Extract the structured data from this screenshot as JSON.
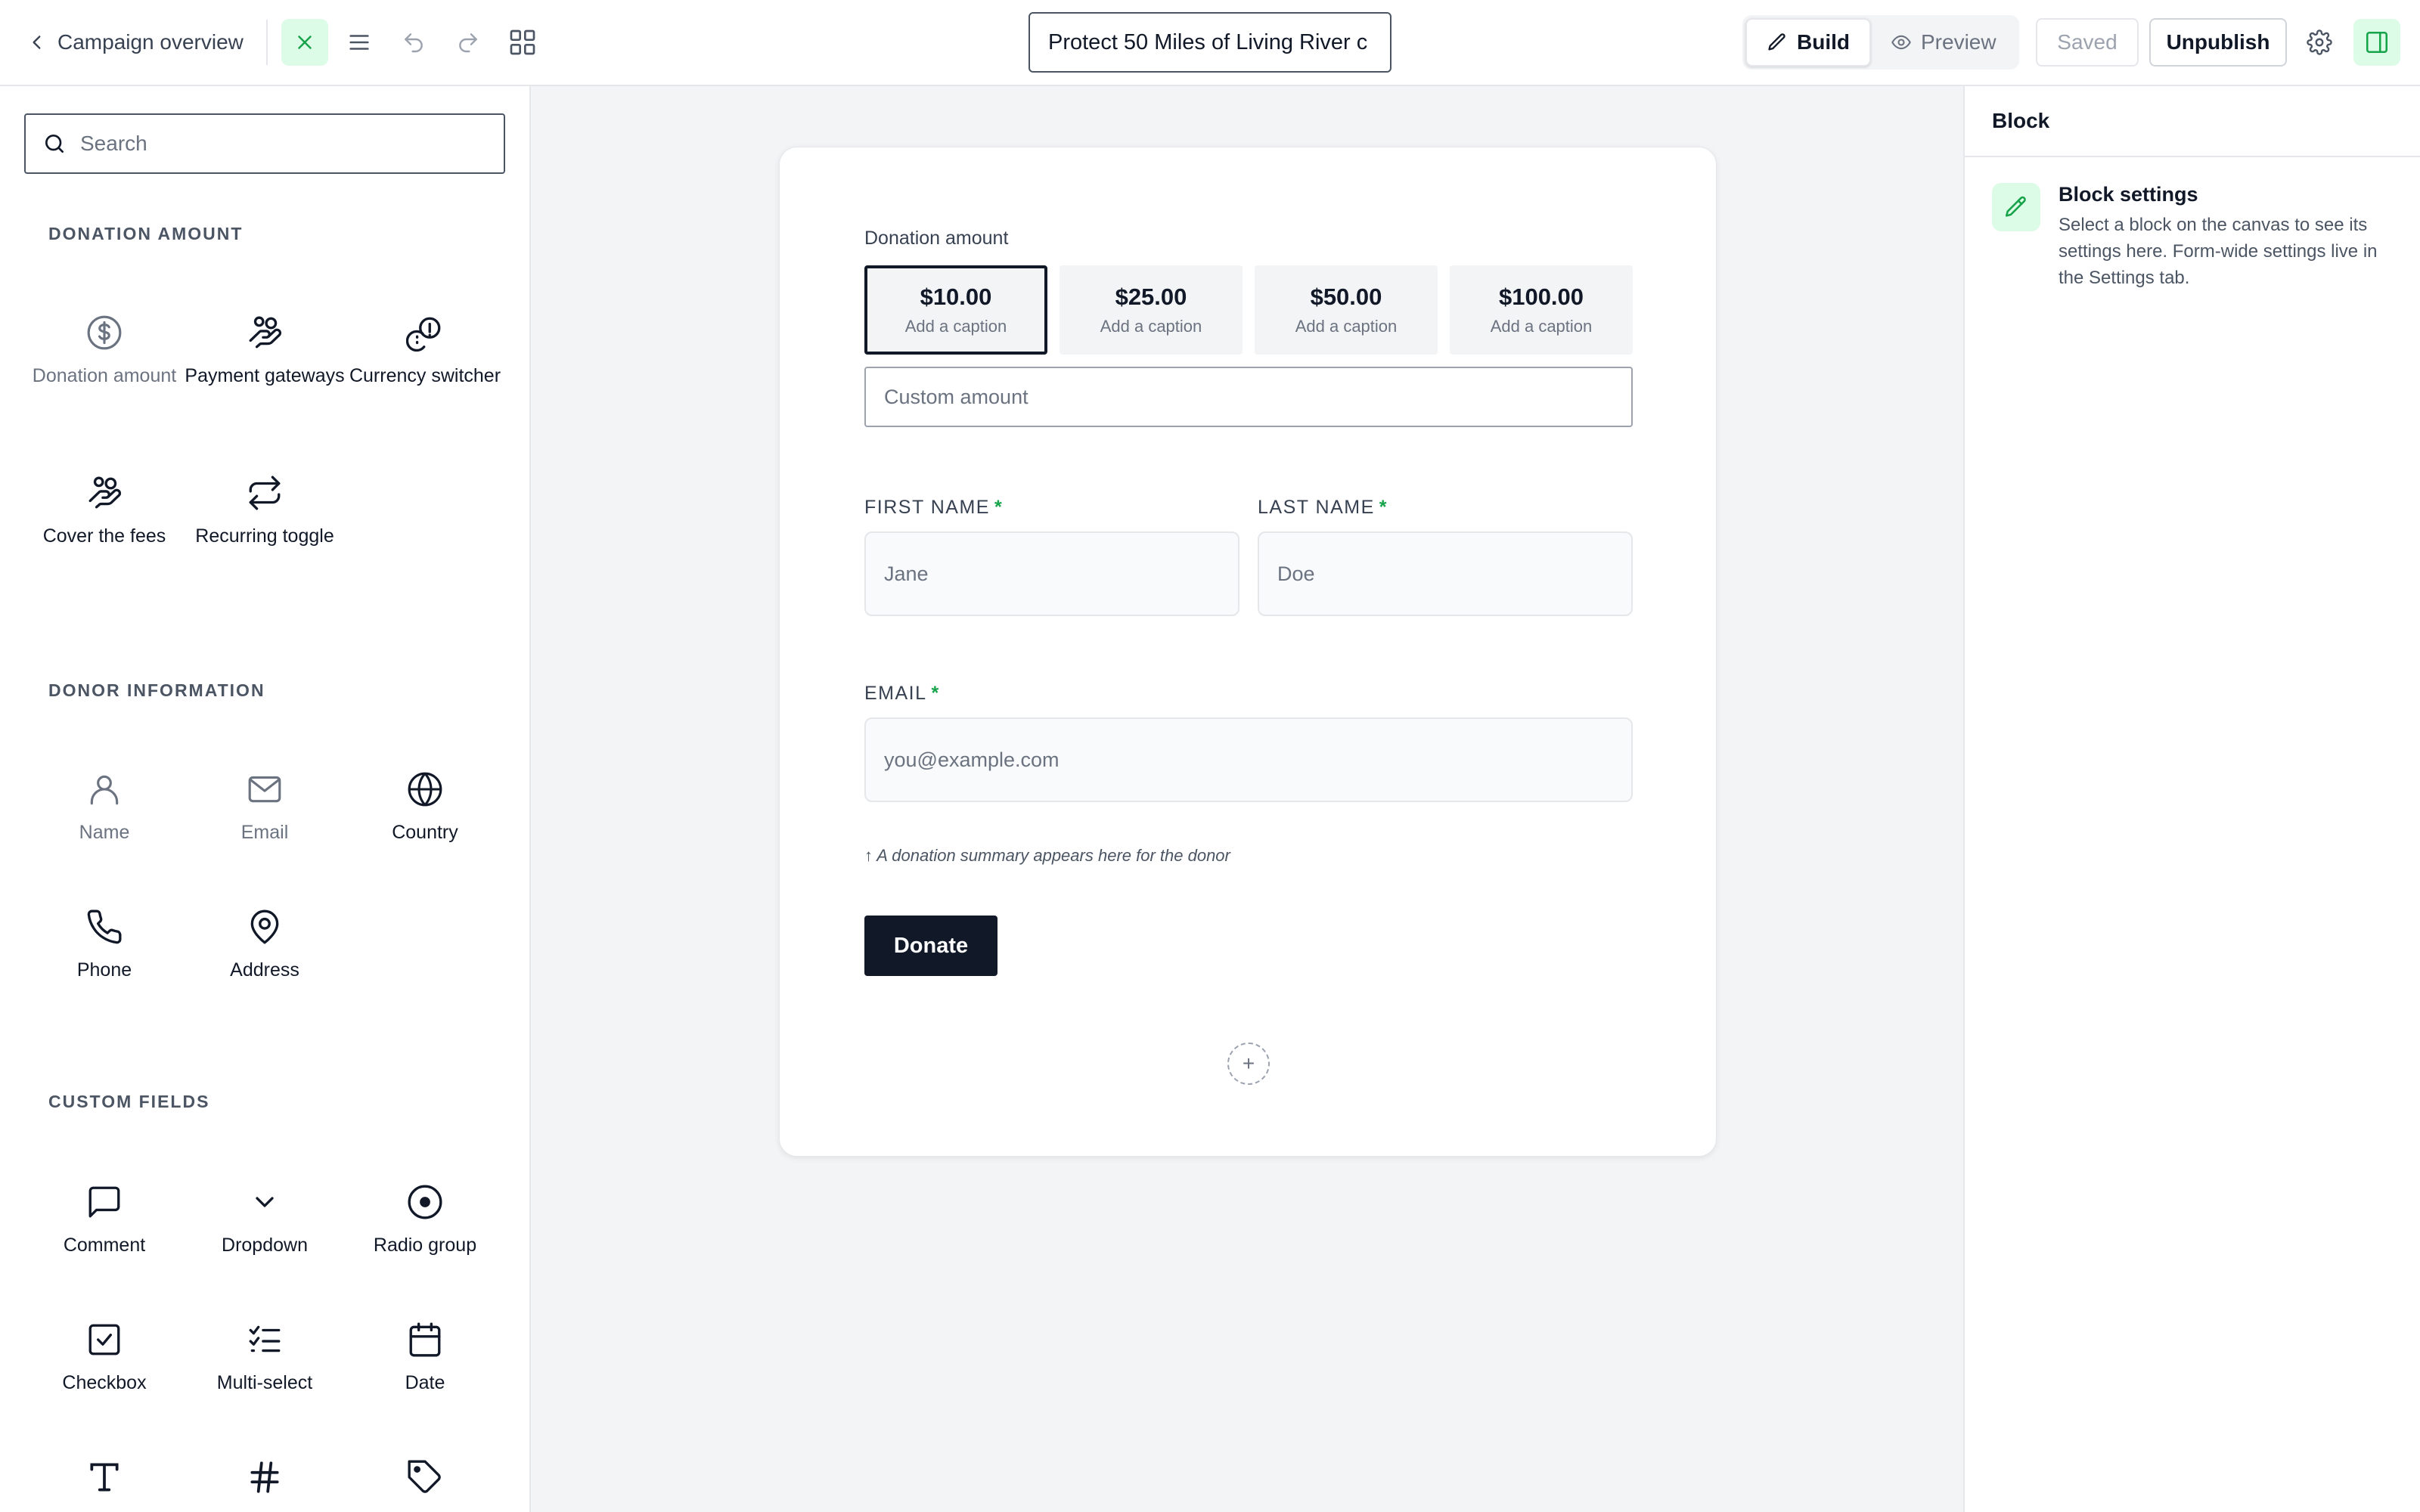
{
  "topbar": {
    "back_label": "Campaign overview",
    "campaign_title": "Protect 50 Miles of Living River c",
    "build_label": "Build",
    "preview_label": "Preview",
    "saved_label": "Saved",
    "unpublish_label": "Unpublish",
    "icons": [
      "chevron-left-icon",
      "close-icon",
      "list-icon",
      "undo-icon",
      "redo-icon",
      "grid-icon",
      "pencil-icon",
      "eye-icon",
      "gear-icon",
      "panel-right-icon"
    ],
    "accent_color": "#16a34a"
  },
  "sidebar": {
    "search_placeholder": "Search",
    "sections": [
      {
        "label": "DONATION AMOUNT",
        "items": [
          {
            "label": "Donation amount",
            "icon": "dollar-circle-icon"
          },
          {
            "label": "Payment gateways",
            "icon": "hand-coins-icon"
          },
          {
            "label": "Currency switcher",
            "icon": "coins-icon"
          },
          {
            "label": "Cover the fees",
            "icon": "hand-coins-icon"
          },
          {
            "label": "Recurring toggle",
            "icon": "repeat-icon"
          }
        ]
      },
      {
        "label": "DONOR INFORMATION",
        "items": [
          {
            "label": "Name",
            "icon": "user-icon"
          },
          {
            "label": "Email",
            "icon": "mail-icon"
          },
          {
            "label": "Country",
            "icon": "globe-icon"
          },
          {
            "label": "Phone",
            "icon": "phone-icon"
          },
          {
            "label": "Address",
            "icon": "map-pin-icon"
          }
        ]
      },
      {
        "label": "CUSTOM FIELDS",
        "items": [
          {
            "label": "Comment",
            "icon": "message-square-icon"
          },
          {
            "label": "Dropdown",
            "icon": "chevron-down-icon"
          },
          {
            "label": "Radio group",
            "icon": "radio-icon"
          },
          {
            "label": "Checkbox",
            "icon": "check-square-icon"
          },
          {
            "label": "Multi-select",
            "icon": "list-checks-icon"
          },
          {
            "label": "Date",
            "icon": "calendar-icon"
          },
          {
            "label": "",
            "icon": "type-icon"
          },
          {
            "label": "",
            "icon": "hash-icon"
          },
          {
            "label": "",
            "icon": "tag-icon"
          }
        ]
      }
    ]
  },
  "form": {
    "donation_label": "Donation amount",
    "amounts": [
      {
        "value": "$10.00",
        "caption": "Add a caption",
        "selected": true
      },
      {
        "value": "$25.00",
        "caption": "Add a caption",
        "selected": false
      },
      {
        "value": "$50.00",
        "caption": "Add a caption",
        "selected": false
      },
      {
        "value": "$100.00",
        "caption": "Add a caption",
        "selected": false
      }
    ],
    "custom_amount_placeholder": "Custom amount",
    "first_name_label": "FIRST NAME",
    "first_name_placeholder": "Jane",
    "last_name_label": "LAST NAME",
    "last_name_placeholder": "Doe",
    "email_label": "EMAIL",
    "email_placeholder": "you@example.com",
    "required_mark": "*",
    "summary_note": "↑ A donation summary appears here for the donor",
    "donate_label": "Donate",
    "add_block_glyph": "+"
  },
  "right_panel": {
    "header": "Block",
    "title": "Block settings",
    "description": "Select a block on the canvas to see its settings here. Form-wide settings live in the Settings tab."
  }
}
